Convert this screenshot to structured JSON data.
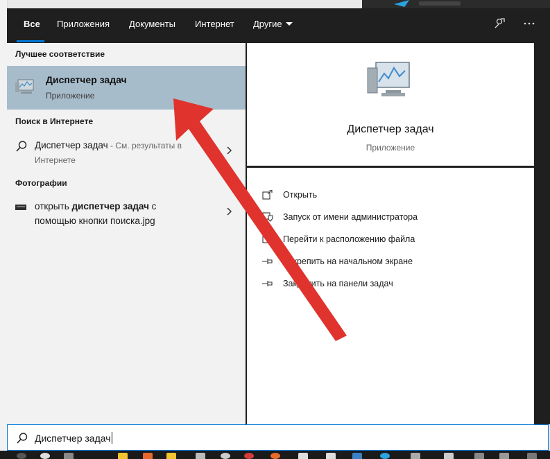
{
  "tabs": [
    "Все",
    "Приложения",
    "Документы",
    "Интернет",
    "Другие"
  ],
  "top_icons": [
    "feedback-icon",
    "more-icon"
  ],
  "left": {
    "best_match_header": "Лучшее соответствие",
    "best_match": {
      "title": "Диспетчер задач",
      "subtitle": "Приложение",
      "icon": "task-manager-icon"
    },
    "web_header": "Поиск в Интернете",
    "web_item": {
      "query": "Диспетчер задач",
      "suffix": " - См. результаты в",
      "line2": "Интернете"
    },
    "photos_header": "Фотографии",
    "photo_item": {
      "line1_prefix": "открыть ",
      "line1_bold": "диспетчер задач",
      "line1_suffix": " с",
      "line2": "помощью кнопки поиска.jpg"
    }
  },
  "right": {
    "app_name": "Диспетчер задач",
    "app_type": "Приложение",
    "actions": [
      {
        "label": "Открыть",
        "icon": "open-icon"
      },
      {
        "label": "Запуск от имени администратора",
        "icon": "shield-icon"
      },
      {
        "label": "Перейти к расположению файла",
        "icon": "file-location-icon"
      },
      {
        "label": "Закрепить на начальном экране",
        "icon": "pin-icon"
      },
      {
        "label": "Закрепить на панели задач",
        "icon": "pin-icon"
      }
    ]
  },
  "search": {
    "value": "Диспетчер задач"
  },
  "colors": {
    "accent": "#0078d7",
    "selected": "#a7bccb",
    "arrow": "#e0332e",
    "dark": "#1f1f1f"
  }
}
